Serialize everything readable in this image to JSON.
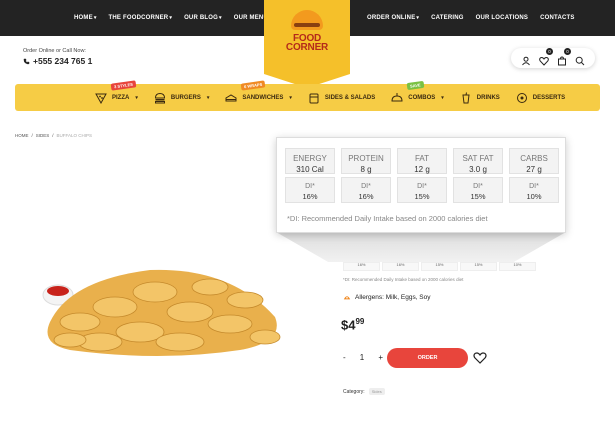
{
  "topnav_left": [
    "HOME",
    "THE FOODCORNER",
    "OUR BLOG",
    "OUR MENU"
  ],
  "topnav_right": [
    "ORDER ONLINE",
    "CATERING",
    "OUR LOCATIONS",
    "CONTACTS"
  ],
  "logo": {
    "line1": "FOOD",
    "line2": "CORNER"
  },
  "contact": {
    "label": "Order Online or Call Now:",
    "phone": "+555 234 765 1"
  },
  "header_icons": {
    "wishlist_count": "0",
    "cart_count": "0"
  },
  "categories": [
    {
      "label": "PIZZA",
      "icon": "pizza-icon",
      "tag": "3 STYLES",
      "tag_color": "#e8453c"
    },
    {
      "label": "BURGERS",
      "icon": "burger-icon"
    },
    {
      "label": "SANDWICHES",
      "icon": "sandwich-icon",
      "tag": "6 WRAPS",
      "tag_color": "#f08a24"
    },
    {
      "label": "SIDES & SALADS",
      "icon": "salad-icon"
    },
    {
      "label": "COMBOS",
      "icon": "combo-icon",
      "tag": "SAVE",
      "tag_color": "#7ac143"
    },
    {
      "label": "DRINKS",
      "icon": "drink-icon"
    },
    {
      "label": "DESSERTS",
      "icon": "dessert-icon"
    }
  ],
  "breadcrumb": [
    "HOME",
    "SIDES",
    "BUFFALO CHIPS"
  ],
  "nutrition": {
    "items": [
      {
        "name": "ENERGY",
        "value": "310 Cal",
        "di_label": "DI*",
        "di": "16%"
      },
      {
        "name": "PROTEIN",
        "value": "8 g",
        "di_label": "DI*",
        "di": "16%"
      },
      {
        "name": "FAT",
        "value": "12 g",
        "di_label": "DI*",
        "di": "15%"
      },
      {
        "name": "SAT FAT",
        "value": "3.0 g",
        "di_label": "DI*",
        "di": "15%"
      },
      {
        "name": "CARBS",
        "value": "27 g",
        "di_label": "DI*",
        "di": "10%"
      }
    ],
    "note": "*DI: Recommended Daily Intake based on 2000 calories diet"
  },
  "small_table_di": [
    "16%",
    "16%",
    "15%",
    "15%",
    "10%"
  ],
  "allergens": "Allergens: Milk, Eggs, Soy",
  "price": {
    "currency": "$",
    "main": "4",
    "cents": "99"
  },
  "quantity": {
    "minus": "-",
    "value": "1",
    "plus": "+"
  },
  "order_label": "ORDER",
  "category": {
    "label": "Category:",
    "value": "Sides"
  },
  "colors": {
    "topbar": "#232323",
    "accent": "#f5c02a",
    "order": "#e8453c"
  }
}
